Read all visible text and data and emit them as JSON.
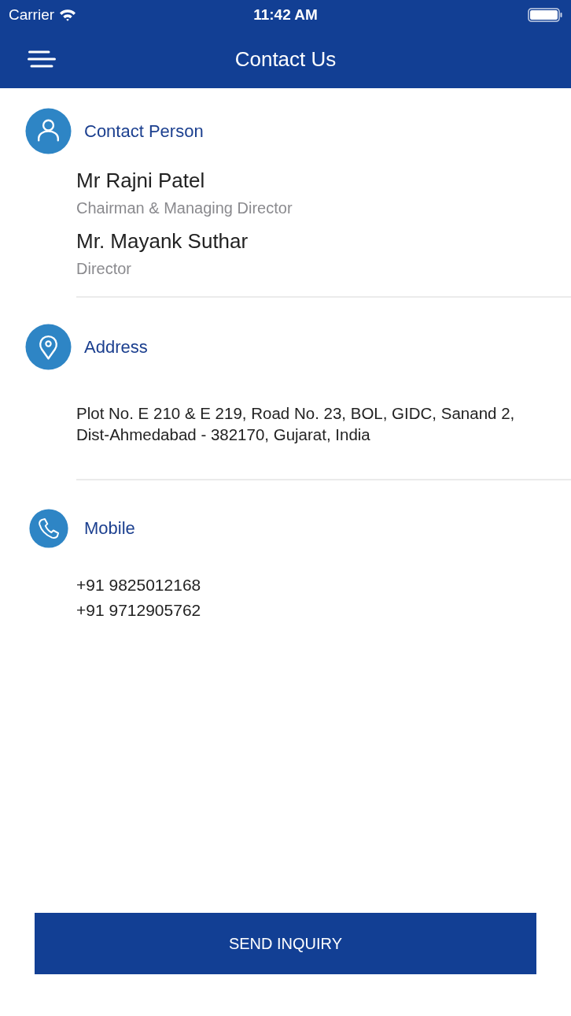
{
  "status_bar": {
    "carrier": "Carrier",
    "time": "11:42 AM"
  },
  "nav_bar": {
    "title": "Contact Us"
  },
  "sections": [
    {
      "kind": "person",
      "title": "Contact Person",
      "people": [
        {
          "name": "Mr Rajni Patel",
          "role": "Chairman & Managing Director"
        },
        {
          "name": "Mr. Mayank Suthar",
          "role": "Director"
        }
      ]
    },
    {
      "kind": "address",
      "title": "Address",
      "text": "Plot No. E 210 & E 219, Road No. 23, BOL, GIDC, Sanand 2, Dist-Ahmedabad - 382170, Gujarat, India"
    },
    {
      "kind": "mobile",
      "title": "Mobile",
      "numbers": [
        "+91 9825012168",
        "+91 9712905762"
      ]
    }
  ],
  "button": {
    "label": "SEND INQUIRY"
  }
}
